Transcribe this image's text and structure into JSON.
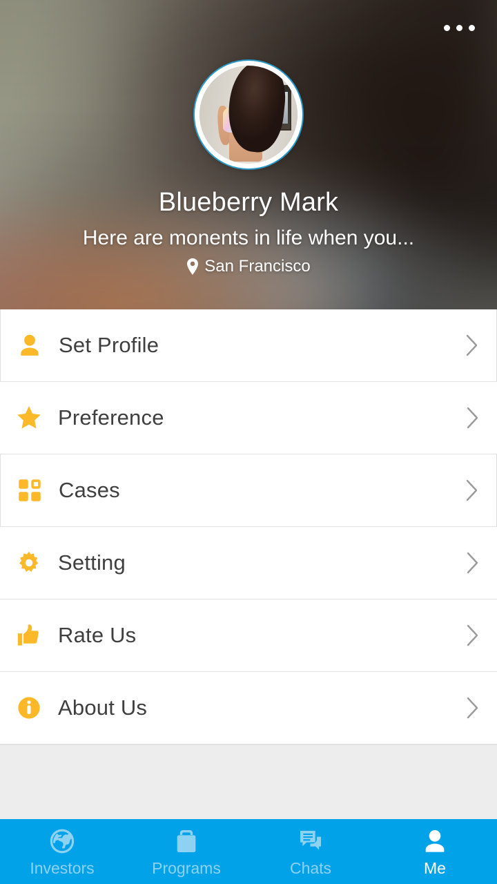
{
  "colors": {
    "accent_amber": "#FBB829",
    "tabbar_blue": "#02A2E8",
    "tab_inactive": "#8ED2F2",
    "tab_active": "#FFFFFF",
    "list_text": "#3F3F3F",
    "filler_gray": "#EDEDED",
    "avatar_ring": "#28AAE1"
  },
  "header": {
    "more_menu": {
      "name": "more-options",
      "dots": 3
    },
    "avatar": {
      "name": "profile-avatar",
      "alt": "Profile photo"
    },
    "name": "Blueberry Mark",
    "bio": "Here are monents in life when you...",
    "location": "San Francisco",
    "location_icon": "map-pin-icon"
  },
  "menu": {
    "items": [
      {
        "label": "Set Profile",
        "icon": "person-icon",
        "chevron": "chevron-right-icon",
        "boxed": true
      },
      {
        "label": "Preference",
        "icon": "star-icon",
        "chevron": "chevron-right-icon",
        "boxed": false
      },
      {
        "label": "Cases",
        "icon": "grid-icon",
        "chevron": "chevron-right-icon",
        "boxed": true
      },
      {
        "label": "Setting",
        "icon": "gear-icon",
        "chevron": "chevron-right-icon",
        "boxed": false
      },
      {
        "label": "Rate Us",
        "icon": "thumbs-up-icon",
        "chevron": "chevron-right-icon",
        "boxed": false
      },
      {
        "label": "About Us",
        "icon": "info-icon",
        "chevron": "chevron-right-icon",
        "boxed": false
      }
    ]
  },
  "tabbar": {
    "tabs": [
      {
        "label": "Investors",
        "icon": "globe-icon",
        "active": false
      },
      {
        "label": "Programs",
        "icon": "briefcase-icon",
        "active": false
      },
      {
        "label": "Chats",
        "icon": "chat-icon",
        "active": false
      },
      {
        "label": "Me",
        "icon": "person-icon",
        "active": true
      }
    ]
  }
}
